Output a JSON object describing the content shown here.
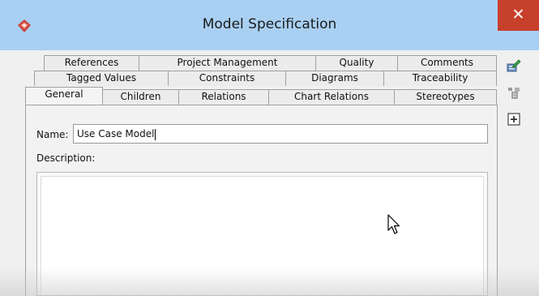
{
  "window": {
    "title": "Model Specification"
  },
  "tabs": {
    "row1": [
      "References",
      "Project Management",
      "Quality",
      "Comments"
    ],
    "row2": [
      "Tagged Values",
      "Constraints",
      "Diagrams",
      "Traceability"
    ],
    "row3": [
      "General",
      "Children",
      "Relations",
      "Chart Relations",
      "Stereotypes"
    ]
  },
  "general": {
    "name_label": "Name:",
    "name_value": "Use Case Model",
    "description_label": "Description:",
    "description_value": ""
  },
  "colors": {
    "titlebar": "#a9d0f2",
    "close": "#c7402c",
    "panel": "#f0f0f0"
  }
}
